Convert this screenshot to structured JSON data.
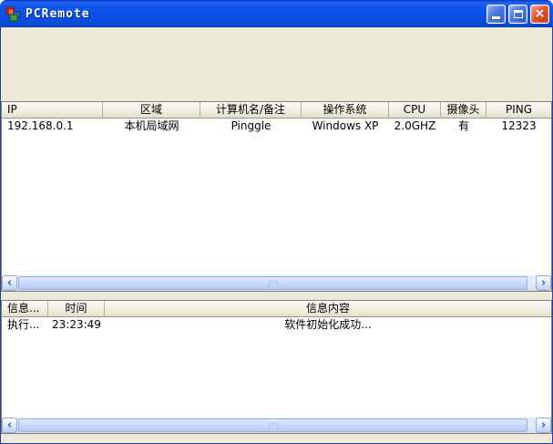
{
  "window": {
    "title": "PCRemote"
  },
  "icons": {
    "minimize": "minimize-icon",
    "maximize": "maximize-icon",
    "close": "close-icon",
    "close_glyph": "×",
    "scroll_left_glyph": "‹",
    "scroll_right_glyph": "›"
  },
  "colors": {
    "titlebar_blue": "#0B50E4",
    "window_border_blue": "#0C55E0",
    "panel_beige": "#ECE9D8",
    "close_button_red": "#E0502A",
    "scrollbar_track": "#DDE6F8"
  },
  "computers_table": {
    "columns": [
      "IP",
      "区域",
      "计算机名/备注",
      "操作系统",
      "CPU",
      "摄像头",
      "PING"
    ],
    "rows": [
      [
        "192.168.0.1",
        "本机局域网",
        "Pinggle",
        "Windows XP",
        "2.0GHZ",
        "有",
        "12323"
      ]
    ]
  },
  "log_table": {
    "columns": [
      "信息...",
      "时间",
      "信息内容"
    ],
    "rows": [
      [
        "执行...",
        "23:23:49",
        "软件初始化成功..."
      ]
    ]
  }
}
